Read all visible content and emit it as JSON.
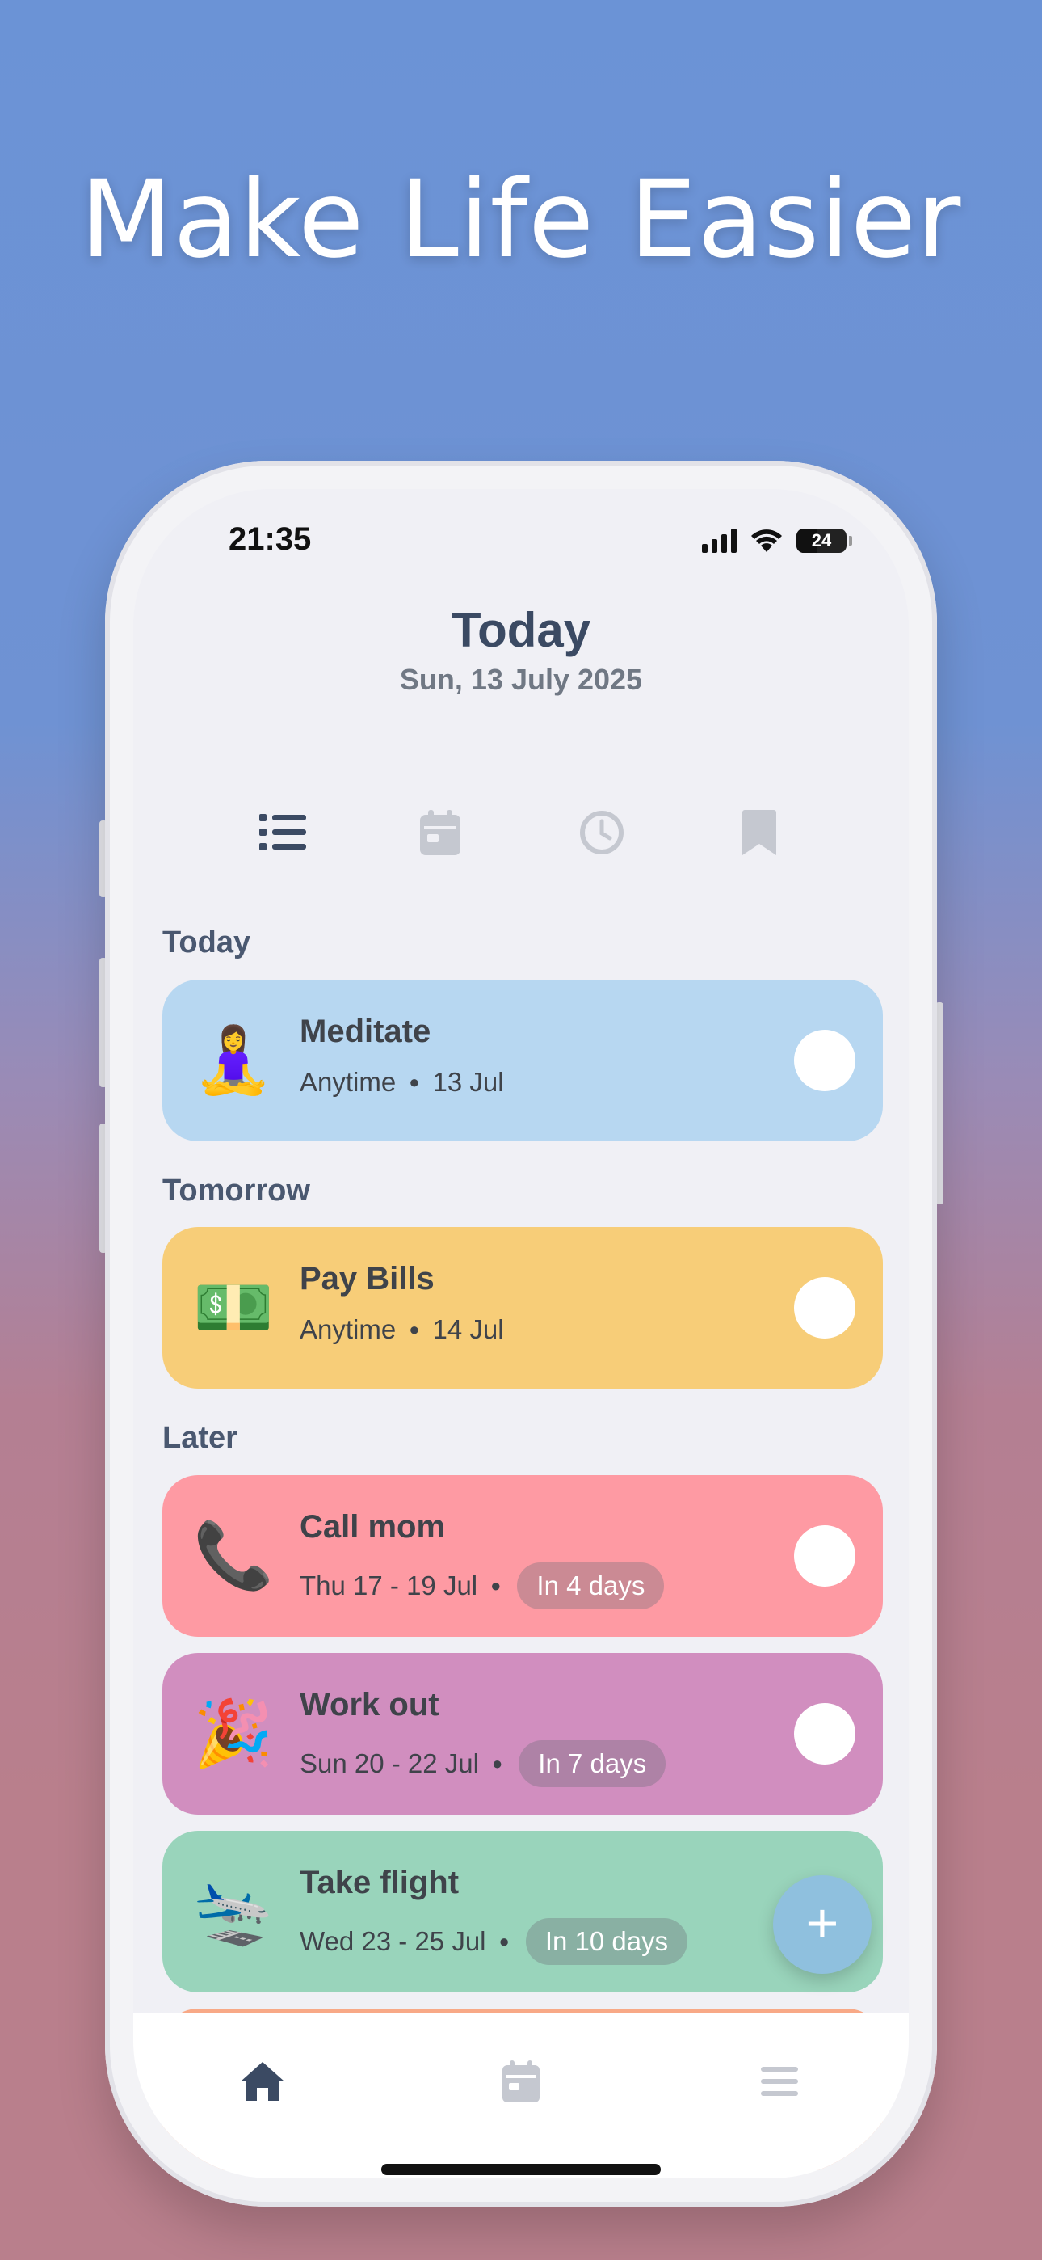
{
  "headline": "Make Life Easier",
  "status": {
    "time": "21:35",
    "battery": "24"
  },
  "header": {
    "title": "Today",
    "date": "Sun, 13 July 2025"
  },
  "tabs": [
    {
      "icon": "list-icon",
      "active": true
    },
    {
      "icon": "calendar-icon",
      "active": false
    },
    {
      "icon": "clock-icon",
      "active": false
    },
    {
      "icon": "bookmark-icon",
      "active": false
    }
  ],
  "sections": {
    "today": "Today",
    "tomorrow": "Tomorrow",
    "later": "Later"
  },
  "tasks": [
    {
      "emoji": "🧘‍♀️",
      "name": "Meditate",
      "when": "Anytime",
      "date": "13 Jul",
      "badge": "",
      "color": "#b7d7f1"
    },
    {
      "emoji": "💵",
      "name": "Pay Bills",
      "when": "Anytime",
      "date": "14 Jul",
      "badge": "",
      "color": "#f7cd78"
    },
    {
      "emoji": "📞",
      "name": "Call mom",
      "when": "Thu 17 - 19 Jul",
      "date": "",
      "badge": "In 4 days",
      "color": "#fe9aa3"
    },
    {
      "emoji": "🎉",
      "name": "Work out",
      "when": "Sun 20 - 22 Jul",
      "date": "",
      "badge": "In 7 days",
      "color": "#d18ebf"
    },
    {
      "emoji": "🛬",
      "name": "Take flight",
      "when": "Wed 23 - 25 Jul",
      "date": "",
      "badge": "In 10 days",
      "color": "#99d4bb"
    }
  ],
  "fab": "+",
  "bottom_nav": [
    {
      "icon": "home-icon",
      "active": true
    },
    {
      "icon": "calendar-icon",
      "active": false
    },
    {
      "icon": "menu-icon",
      "active": false
    }
  ],
  "colors": {
    "accent": "#3b4a63",
    "inactive_icon": "#c5c8d0",
    "fab": "#8fc0de"
  }
}
